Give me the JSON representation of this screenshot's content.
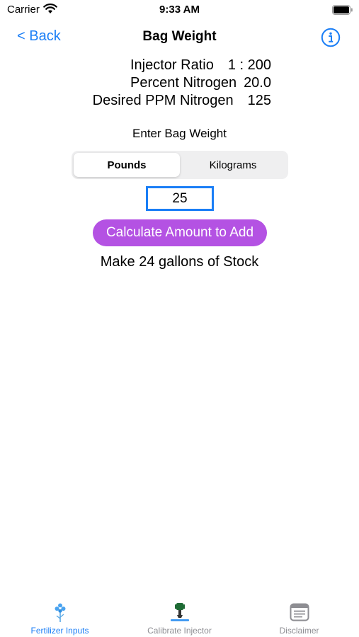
{
  "status_bar": {
    "carrier": "Carrier",
    "time": "9:33 AM"
  },
  "nav": {
    "back_label": "< Back",
    "title": "Bag Weight"
  },
  "summary": [
    {
      "label": "Injector Ratio",
      "value": "1 : 200"
    },
    {
      "label": "Percent Nitrogen",
      "value": "20.0"
    },
    {
      "label": "Desired PPM Nitrogen",
      "value": "125"
    }
  ],
  "enter_label": "Enter Bag Weight",
  "units": {
    "options": [
      "Pounds",
      "Kilograms"
    ],
    "selected": "Pounds"
  },
  "weight_input": {
    "value": "25"
  },
  "calc_button_label": "Calculate Amount to Add",
  "result_text": "Make 24 gallons of Stock",
  "tabs": [
    {
      "label": "Fertilizer Inputs",
      "icon": "fertilizer-icon",
      "active": true
    },
    {
      "label": "Calibrate Injector",
      "icon": "injector-icon",
      "active": false
    },
    {
      "label": "Disclaimer",
      "icon": "disclaimer-icon",
      "active": false
    }
  ],
  "colors": {
    "accent": "#1a7ef6",
    "button_purple": "#b452e3",
    "inactive_tab": "#8e8e93"
  }
}
